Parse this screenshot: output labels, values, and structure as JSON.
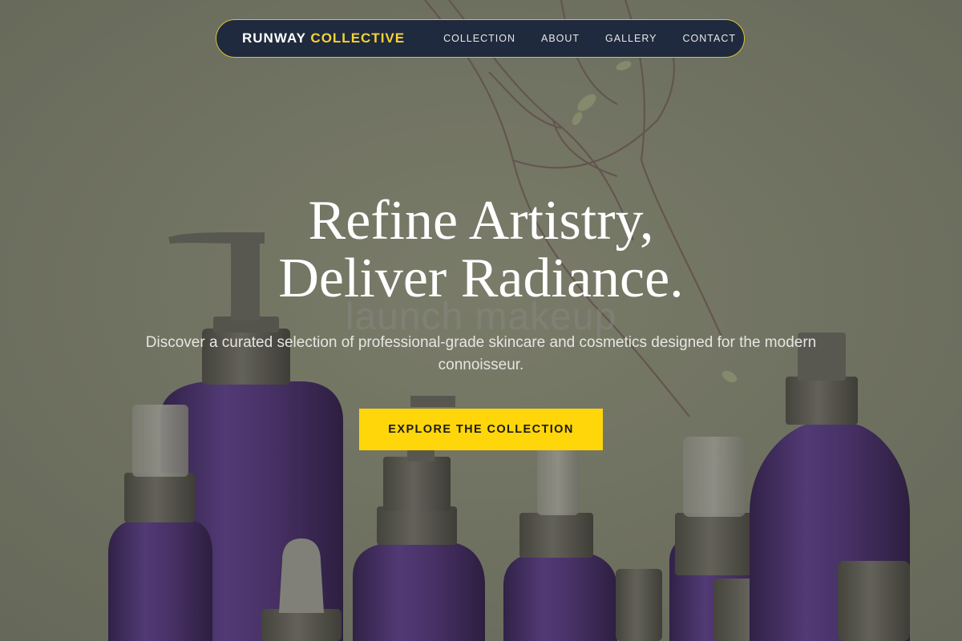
{
  "nav": {
    "brand_primary": "RUNWAY",
    "brand_accent": "COLLECTIVE",
    "links": [
      "COLLECTION",
      "ABOUT",
      "GALLERY",
      "CONTACT"
    ]
  },
  "hero": {
    "title_line1": "Refine Artistry,",
    "title_line2": "Deliver Radiance.",
    "subtitle": "Discover a curated selection of professional-grade skincare and cosmetics designed for the modern connoisseur.",
    "cta_label": "EXPLORE THE COLLECTION",
    "background_text": "launch makeup"
  },
  "colors": {
    "nav_bg": "#1f2a3e",
    "nav_border": "#d7c235",
    "accent": "#f7d232",
    "cta_bg": "#ffd60a",
    "page_bg": "#7d7f6c",
    "bottle_purple": "#4b2f72",
    "cap_gray": "#5e5c55"
  }
}
